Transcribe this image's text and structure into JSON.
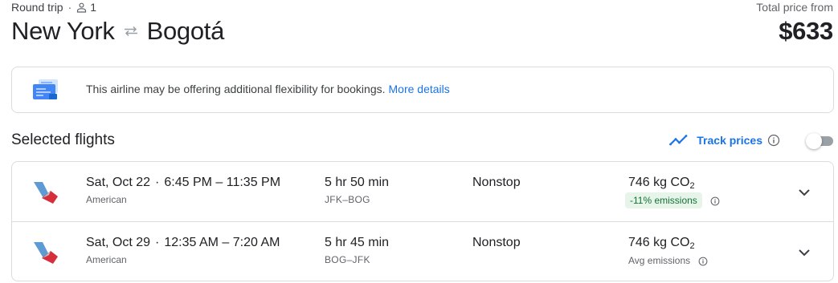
{
  "header": {
    "trip_type": "Round trip",
    "separator": "·",
    "passengers": "1",
    "origin": "New York",
    "destination": "Bogotá",
    "price_label": "Total price from",
    "price": "$633"
  },
  "notice": {
    "text": "This airline may be offering additional flexibility for bookings.",
    "link": "More details"
  },
  "selected": {
    "title": "Selected flights",
    "track_label": "Track prices",
    "track_enabled": false
  },
  "flights": [
    {
      "date": "Sat, Oct 22",
      "sep": "·",
      "times": "6:45 PM – 11:35 PM",
      "airline": "American",
      "duration": "5 hr 50 min",
      "route": "JFK–BOG",
      "stops": "Nonstop",
      "co2_value": "746 kg CO",
      "co2_sub": "2",
      "emissions": "-11% emissions",
      "emissions_style": "badge"
    },
    {
      "date": "Sat, Oct 29",
      "sep": "·",
      "times": "12:35 AM – 7:20 AM",
      "airline": "American",
      "duration": "5 hr 45 min",
      "route": "BOG–JFK",
      "stops": "Nonstop",
      "co2_value": "746 kg CO",
      "co2_sub": "2",
      "emissions": "Avg emissions",
      "emissions_style": "text"
    }
  ],
  "colors": {
    "link": "#1a73e8",
    "badge_bg": "#e6f4ea",
    "badge_text": "#137333",
    "border": "#dadce0"
  },
  "icons": {
    "person": "person-icon",
    "swap": "swap-arrows-icon",
    "flex": "flexible-booking-icon",
    "trend": "trending-chart-icon",
    "info": "info-icon",
    "expand": "chevron-down-icon",
    "airline": "american-airlines-logo"
  }
}
